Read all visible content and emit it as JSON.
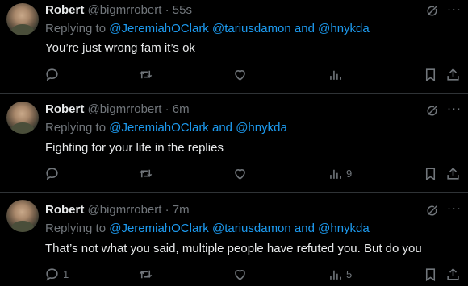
{
  "tweets": [
    {
      "author": "Robert",
      "handle": "@bigmrrobert",
      "separator": "·",
      "time": "55s",
      "replying_prefix": "Replying to",
      "mention_a": "@JeremiahOClark @tariusdamon",
      "and": "and",
      "mention_b": "@hnykda",
      "text": "You’re just wrong fam it’s ok",
      "reply_count": "",
      "views_count": ""
    },
    {
      "author": "Robert",
      "handle": "@bigmrrobert",
      "separator": "·",
      "time": "6m",
      "replying_prefix": "Replying to",
      "mention_a": "@JeremiahOClark",
      "and": "and",
      "mention_b": "@hnykda",
      "text": "Fighting for your life in the replies",
      "reply_count": "",
      "views_count": "9"
    },
    {
      "author": "Robert",
      "handle": "@bigmrrobert",
      "separator": "·",
      "time": "7m",
      "replying_prefix": "Replying to",
      "mention_a": "@JeremiahOClark @tariusdamon",
      "and": "and",
      "mention_b": "@hnykda",
      "text": "That’s not what you said, multiple people have refuted you. But do you",
      "reply_count": "1",
      "views_count": "5"
    }
  ],
  "icons": {
    "reply": "reply-icon",
    "retweet": "retweet-icon",
    "like": "like-icon",
    "views": "views-icon",
    "bookmark": "bookmark-icon",
    "share": "share-icon",
    "grok": "grok-icon",
    "more": "more-icon"
  },
  "colors": {
    "background": "#000000",
    "text": "#e7e9ea",
    "muted": "#71767b",
    "link": "#1d9bf0",
    "divider": "#2f3336"
  }
}
